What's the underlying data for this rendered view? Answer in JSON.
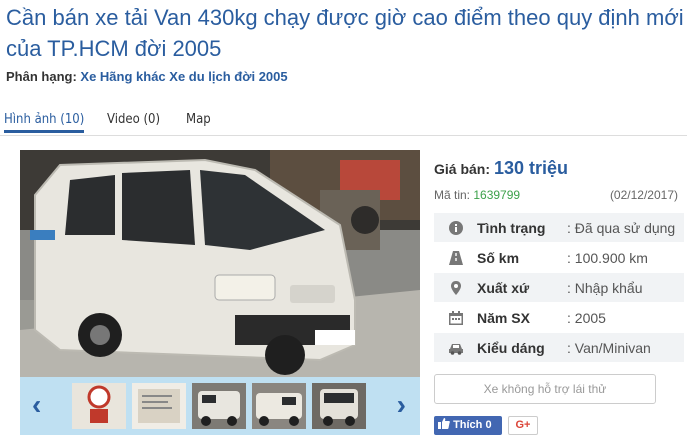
{
  "listing": {
    "title": "Cần bán xe tải Van 430kg chạy được giờ cao điểm theo quy định mới của TP.HCM đời 2005",
    "category_label": "Phân hạng:",
    "category_value": "Xe Hãng khác Xe du lịch đời 2005"
  },
  "tabs": [
    {
      "label": "Hình ảnh (10)",
      "active": true
    },
    {
      "label": "Video (0)",
      "active": false
    },
    {
      "label": "Map",
      "active": false
    }
  ],
  "gallery": {
    "prev_icon": "‹",
    "next_icon": "›",
    "main_photo_icon": "van-photo",
    "thumbnails": [
      "sign-thumb",
      "document-thumb",
      "van-thumb",
      "van-thumb",
      "van-thumb"
    ]
  },
  "info": {
    "price_label": "Giá bán:",
    "price_value": "130 triệu",
    "id_label": "Mã tin:",
    "id_value": "1639799",
    "date": "(02/12/2017)",
    "specs": [
      {
        "icon": "info-icon",
        "key": "Tình trạng",
        "value": ": Đã qua sử dụng"
      },
      {
        "icon": "road-icon",
        "key": "Số km",
        "value": ": 100.900 km"
      },
      {
        "icon": "location-pin-icon",
        "key": "Xuất xứ",
        "value": ": Nhập khẩu"
      },
      {
        "icon": "calendar-icon",
        "key": "Năm SX",
        "value": ": 2005"
      },
      {
        "icon": "car-icon",
        "key": "Kiểu dáng",
        "value": ": Van/Minivan"
      }
    ],
    "test_drive_label": "Xe không hỗ trợ lái thử",
    "like_label": "Thích 0",
    "gplus_label": "G+"
  },
  "colors": {
    "brand_blue": "#2a5d9f",
    "id_green": "#3ca14a",
    "thumb_strip": "#bfe0f2",
    "facebook": "#4267b2"
  }
}
